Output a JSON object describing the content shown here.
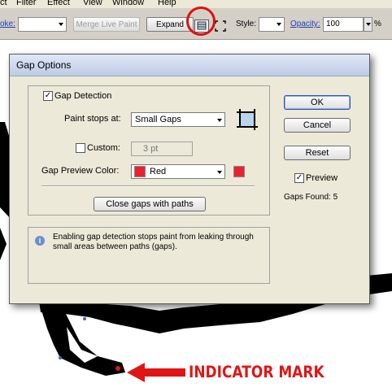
{
  "menubar": {
    "items": [
      "ct",
      "Filter",
      "Effect",
      "View",
      "Window",
      "Help"
    ]
  },
  "toolbar": {
    "stroke_label": "oke:",
    "merge_label": "Merge Live Paint",
    "expand_label": "Expand",
    "style_label": "Style:",
    "opacity_label": "Opacity:",
    "opacity_value": "100",
    "percent": "%"
  },
  "dialog": {
    "title": "Gap Options",
    "gap_detection_label": "Gap Detection",
    "gap_detection_checked": true,
    "paint_stops_label": "Paint stops at:",
    "paint_stops_value": "Small Gaps",
    "custom_label": "Custom:",
    "custom_value": "3 pt",
    "preview_color_label": "Gap Preview Color:",
    "preview_color_value": "Red",
    "preview_color_hex": "#e8232f",
    "close_gaps_label": "Close gaps with paths",
    "ok_label": "OK",
    "cancel_label": "Cancel",
    "reset_label": "Reset",
    "preview_label": "Preview",
    "preview_checked": true,
    "gaps_found": "Gaps Found: 5",
    "info_text": "Enabling gap detection stops paint from leaking through small areas between paths (gaps)."
  },
  "annotation": {
    "indicator_text": "INDICATOR MARK",
    "color": "#e01515"
  }
}
